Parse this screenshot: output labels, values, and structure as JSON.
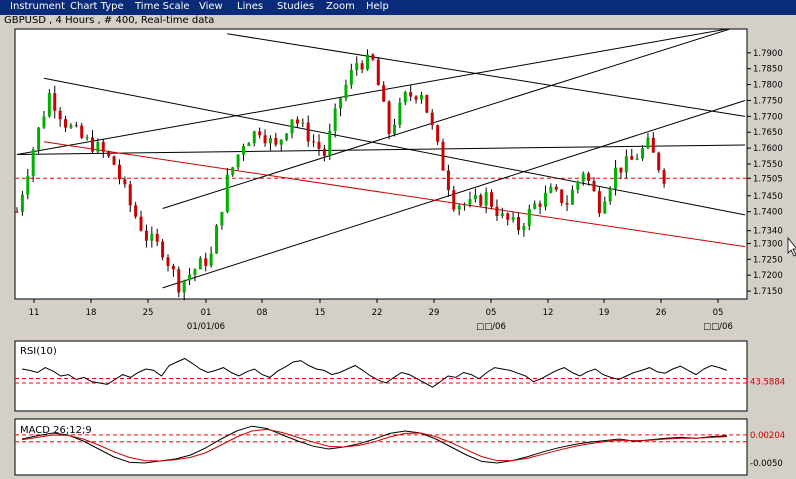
{
  "menu": [
    "Instrument",
    "Chart Type",
    "Time Scale",
    "View",
    "Lines",
    "Studies",
    "Zoom",
    "Help"
  ],
  "chart_title": "GBPUSD , 4 Hours , # 400, Real-time data",
  "colors": {
    "up": "#00b000",
    "down": "#cc0000",
    "wick": "#000000",
    "menubar": "#0a2a7a",
    "trend_red": "#cc0000",
    "dashed": "#ff0000"
  },
  "chart_data": [
    {
      "type": "candlestick",
      "title": "GBPUSD , 4 Hours , # 400, Real-time data",
      "ylim": [
        1.7125,
        1.7975
      ],
      "y_ticks": [
        1.715,
        1.72,
        1.725,
        1.73,
        1.734,
        1.74,
        1.745,
        1.7505,
        1.755,
        1.76,
        1.765,
        1.77,
        1.775,
        1.78,
        1.785,
        1.79
      ],
      "y_tick_labels": [
        "1.7150",
        "1.7200",
        "1.7250",
        "1.7300",
        "1.7340",
        "1.7400",
        "1.7450",
        "1.7505",
        "1.7550",
        "1.7600",
        "1.7650",
        "1.7700",
        "1.7750",
        "1.7800",
        "1.7850",
        "1.7900"
      ],
      "current_price": 1.7505,
      "current_price_label": "1.7505",
      "x_ticks": [
        "11",
        "18",
        "25",
        "01",
        "08",
        "15",
        "22",
        "29",
        "05",
        "12",
        "19",
        "26",
        "05"
      ],
      "x_subticks": [
        "01/01/06",
        "□□/06",
        "□□/06"
      ],
      "close_path": [
        [
          0,
          1.74
        ],
        [
          3,
          1.76
        ],
        [
          6,
          1.777
        ],
        [
          9,
          1.768
        ],
        [
          12,
          1.763
        ],
        [
          15,
          1.76
        ],
        [
          18,
          1.755
        ],
        [
          21,
          1.742
        ],
        [
          24,
          1.732
        ],
        [
          27,
          1.728
        ],
        [
          30,
          1.717
        ],
        [
          33,
          1.722
        ],
        [
          36,
          1.726
        ],
        [
          39,
          1.75
        ],
        [
          42,
          1.762
        ],
        [
          45,
          1.766
        ],
        [
          48,
          1.76
        ],
        [
          51,
          1.77
        ],
        [
          54,
          1.764
        ],
        [
          57,
          1.758
        ],
        [
          60,
          1.776
        ],
        [
          63,
          1.787
        ],
        [
          66,
          1.787
        ],
        [
          69,
          1.765
        ],
        [
          72,
          1.776
        ],
        [
          75,
          1.778
        ],
        [
          78,
          1.76
        ],
        [
          81,
          1.743
        ],
        [
          84,
          1.742
        ],
        [
          87,
          1.745
        ],
        [
          90,
          1.738
        ],
        [
          93,
          1.735
        ],
        [
          96,
          1.742
        ],
        [
          99,
          1.746
        ],
        [
          102,
          1.743
        ],
        [
          105,
          1.753
        ],
        [
          108,
          1.742
        ],
        [
          111,
          1.753
        ],
        [
          114,
          1.756
        ],
        [
          117,
          1.761
        ],
        [
          120,
          1.751
        ]
      ],
      "trendlines": [
        {
          "color": "black",
          "p1": [
            0,
            1.758
          ],
          "p2": [
            135,
            1.7985
          ]
        },
        {
          "color": "black",
          "p1": [
            0,
            1.758
          ],
          "p2": [
            135,
            1.761
          ]
        },
        {
          "color": "black",
          "p1": [
            5,
            1.782
          ],
          "p2": [
            135,
            1.739
          ]
        },
        {
          "color": "black",
          "p1": [
            27,
            1.716
          ],
          "p2": [
            135,
            1.775
          ]
        },
        {
          "color": "black",
          "p1": [
            27,
            1.741
          ],
          "p2": [
            135,
            1.799
          ]
        },
        {
          "color": "black",
          "p1": [
            39,
            1.796
          ],
          "p2": [
            135,
            1.77
          ]
        },
        {
          "color": "red",
          "p1": [
            5,
            1.762
          ],
          "p2": [
            135,
            1.729
          ]
        }
      ]
    },
    {
      "type": "line",
      "title": "RSI(10)",
      "ylim": [
        0,
        100
      ],
      "levels": [
        46.5,
        40.0
      ],
      "level_label": "43.5884",
      "series": [
        {
          "name": "RSI(10)",
          "values": [
            60,
            58,
            55,
            62,
            57,
            50,
            52,
            45,
            48,
            42,
            40,
            38,
            45,
            52,
            48,
            55,
            60,
            58,
            50,
            65,
            70,
            75,
            68,
            60,
            55,
            58,
            62,
            55,
            50,
            56,
            60,
            52,
            48,
            57,
            63,
            70,
            72,
            65,
            60,
            58,
            52,
            55,
            60,
            65,
            58,
            50,
            44,
            40,
            48,
            55,
            52,
            46,
            40,
            34,
            42,
            50,
            48,
            55,
            52,
            46,
            55,
            62,
            60,
            58,
            54,
            50,
            42,
            46,
            52,
            58,
            62,
            55,
            50,
            56,
            60,
            52,
            48,
            45,
            50,
            55,
            58,
            62,
            56,
            54,
            60,
            64,
            58,
            52,
            60,
            65,
            62,
            58
          ]
        }
      ]
    },
    {
      "type": "line",
      "title": "MACD 26;12;9",
      "ylim": [
        -0.008,
        0.006
      ],
      "levels": [
        0.00204,
        0.0003
      ],
      "tick_label": "-0.0050",
      "level_label": "0.00204",
      "series": [
        {
          "name": "MACD",
          "values": [
            0.001,
            0.0018,
            0.0025,
            0.002,
            0.0005,
            -0.0015,
            -0.0035,
            -0.0048,
            -0.005,
            -0.0045,
            -0.004,
            -0.003,
            -0.0012,
            0.001,
            0.003,
            0.0042,
            0.0036,
            0.002,
            0.0005,
            -0.0008,
            -0.0015,
            -0.001,
            -0.0002,
            0.001,
            0.0024,
            0.003,
            0.0025,
            0.001,
            -0.001,
            -0.003,
            -0.0046,
            -0.005,
            -0.0044,
            -0.0034,
            -0.0022,
            -0.0012,
            -0.0004,
            0.0002,
            0.0006,
            0.001,
            0.0004,
            0.0008,
            0.0012,
            0.0014,
            0.0012,
            0.0016,
            0.0018
          ]
        },
        {
          "name": "Signal",
          "values": [
            0.0008,
            0.0014,
            0.002,
            0.0019,
            0.001,
            -0.0005,
            -0.0022,
            -0.0036,
            -0.0044,
            -0.0045,
            -0.0042,
            -0.0036,
            -0.0024,
            -0.0005,
            0.0015,
            0.003,
            0.0034,
            0.0026,
            0.0014,
            0.0002,
            -0.0008,
            -0.001,
            -0.0006,
            0.0003,
            0.0015,
            0.0024,
            0.0025,
            0.0016,
            0.0001,
            -0.0017,
            -0.0034,
            -0.0044,
            -0.0044,
            -0.0038,
            -0.0028,
            -0.0018,
            -0.0009,
            -0.0002,
            0.0003,
            0.0007,
            0.0006,
            0.0007,
            0.001,
            0.0012,
            0.0012,
            0.0014,
            0.0016
          ]
        }
      ]
    }
  ]
}
